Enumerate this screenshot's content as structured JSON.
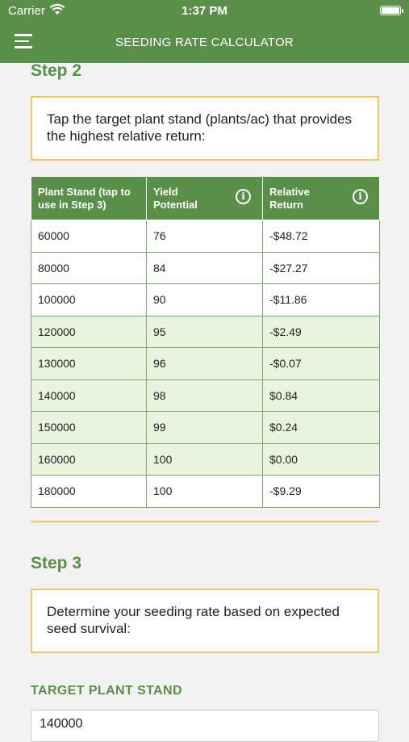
{
  "status_bar": {
    "carrier": "Carrier",
    "time": "1:37 PM"
  },
  "nav": {
    "title": "SEEDING RATE CALCULATOR"
  },
  "step2": {
    "title": "Step 2",
    "instruction": "Tap the target plant stand (plants/ac) that provides the highest relative return:"
  },
  "table": {
    "headers": [
      "Plant Stand (tap to use in Step 3)",
      "Yield Potential",
      "Relative Return"
    ],
    "rows": [
      {
        "stand": "60000",
        "yield": "76",
        "ret": "-$48.72",
        "highlight": false,
        "negative": true
      },
      {
        "stand": "80000",
        "yield": "84",
        "ret": "-$27.27",
        "highlight": false,
        "negative": true
      },
      {
        "stand": "100000",
        "yield": "90",
        "ret": "-$11.86",
        "highlight": false,
        "negative": true
      },
      {
        "stand": "120000",
        "yield": "95",
        "ret": "-$2.49",
        "highlight": true,
        "negative": true
      },
      {
        "stand": "130000",
        "yield": "96",
        "ret": "-$0.07",
        "highlight": true,
        "negative": true
      },
      {
        "stand": "140000",
        "yield": "98",
        "ret": "$0.84",
        "highlight": true,
        "negative": false
      },
      {
        "stand": "150000",
        "yield": "99",
        "ret": "$0.24",
        "highlight": true,
        "negative": false
      },
      {
        "stand": "160000",
        "yield": "100",
        "ret": "$0.00",
        "highlight": true,
        "negative": false
      },
      {
        "stand": "180000",
        "yield": "100",
        "ret": "-$9.29",
        "highlight": false,
        "negative": true
      }
    ]
  },
  "step3": {
    "title": "Step 3",
    "instruction": "Determine your seeding rate based on expected seed survival:",
    "target_label": "TARGET PLANT STAND",
    "target_value": "140000"
  },
  "colors": {
    "primary_green": "#5a8f49",
    "accent_gold": "#f0c66a",
    "negative_red": "#c0392b",
    "highlight_row": "#e8f3e0"
  },
  "icons": {
    "info": "info-icon",
    "menu": "hamburger-menu-icon"
  }
}
